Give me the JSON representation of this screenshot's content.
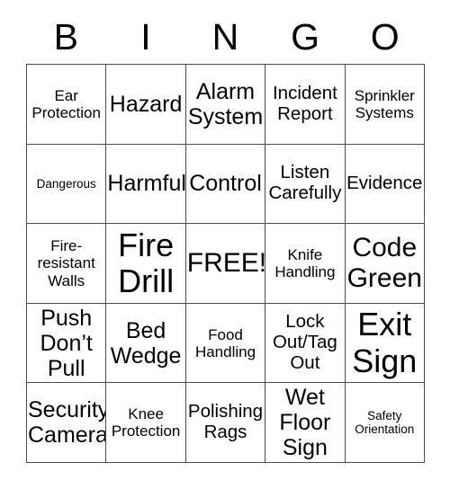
{
  "header": {
    "letters": [
      "B",
      "I",
      "N",
      "G",
      "O"
    ]
  },
  "grid": {
    "rows": 5,
    "columns": 5,
    "border_color": "#4d4d4d",
    "background_color": "#ffffff",
    "text_color": "#000000",
    "cells": [
      {
        "text": "Ear\nProtection",
        "size": "s"
      },
      {
        "text": "Hazard",
        "size": "l"
      },
      {
        "text": "Alarm\nSystem",
        "size": "l"
      },
      {
        "text": "Incident\nReport",
        "size": "m"
      },
      {
        "text": "Sprinkler\nSystems",
        "size": "s"
      },
      {
        "text": "Dangerous",
        "size": "xs"
      },
      {
        "text": "Harmful",
        "size": "l"
      },
      {
        "text": "Control",
        "size": "l"
      },
      {
        "text": "Listen\nCarefully",
        "size": "m"
      },
      {
        "text": "Evidence",
        "size": "m"
      },
      {
        "text": "Fire-\nresistant\nWalls",
        "size": "s"
      },
      {
        "text": "Fire\nDrill",
        "size": "xxl"
      },
      {
        "text": "FREE!",
        "size": "xl"
      },
      {
        "text": "Knife\nHandling",
        "size": "s"
      },
      {
        "text": "Code\nGreen",
        "size": "xl"
      },
      {
        "text": "Push\nDon’t\nPull",
        "size": "l"
      },
      {
        "text": "Bed\nWedge",
        "size": "l"
      },
      {
        "text": "Food\nHandling",
        "size": "s"
      },
      {
        "text": "Lock\nOut/Tag\nOut",
        "size": "m"
      },
      {
        "text": "Exit\nSign",
        "size": "xxl"
      },
      {
        "text": "Security\nCamera",
        "size": "l"
      },
      {
        "text": "Knee\nProtection",
        "size": "s"
      },
      {
        "text": "Polishing\nRags",
        "size": "m"
      },
      {
        "text": "Wet\nFloor\nSign",
        "size": "l"
      },
      {
        "text": "Safety\nOrientation",
        "size": "xs"
      }
    ]
  }
}
